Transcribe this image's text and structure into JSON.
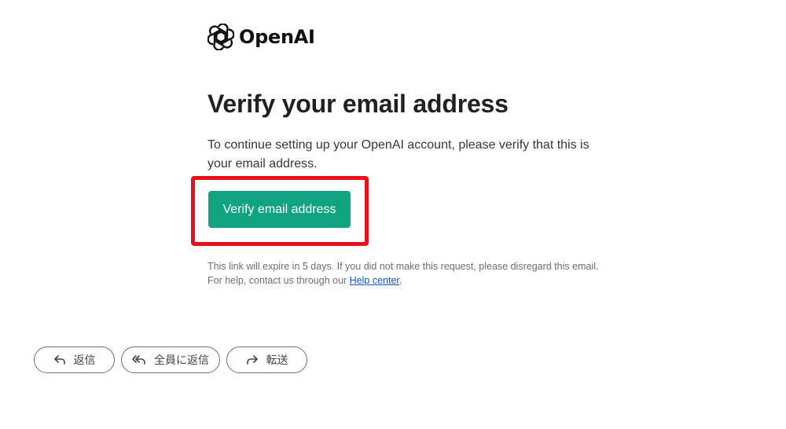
{
  "brand": {
    "logo_icon": "openai-logo-icon",
    "name": "OpenAI"
  },
  "email": {
    "title": "Verify your email address",
    "body": "To continue setting up your OpenAI account, please verify that this is your email address.",
    "button_label": "Verify email address",
    "button_color": "#10a37f",
    "highlight_color": "#e8111b",
    "footer_line1": "This link will expire in 5 days. If you did not make this request, please disregard this email.",
    "footer_line2_prefix": "For help, contact us through our ",
    "help_link_label": "Help center",
    "footer_line2_suffix": "."
  },
  "actions": {
    "reply_label": "返信",
    "reply_icon": "reply-icon",
    "reply_all_label": "全員に返信",
    "reply_all_icon": "reply-all-icon",
    "forward_label": "転送",
    "forward_icon": "forward-icon"
  }
}
